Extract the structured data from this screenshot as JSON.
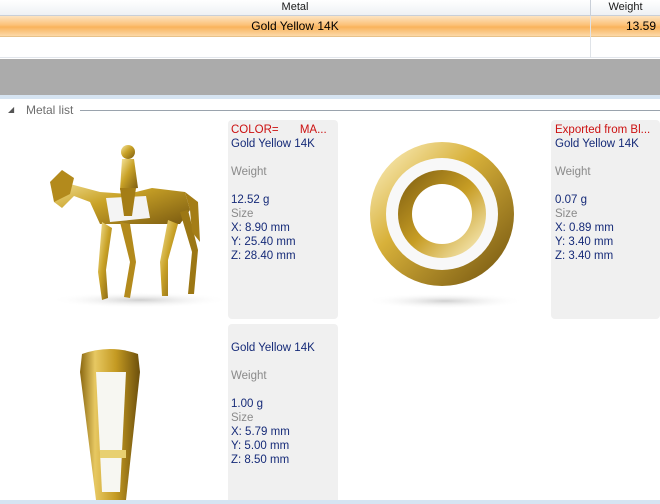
{
  "grid": {
    "columns": {
      "metal": "Metal",
      "weight": "Weight"
    },
    "rows": [
      {
        "metal": "Gold Yellow 14K",
        "weight": "13.59"
      }
    ]
  },
  "group": {
    "title": "Metal list"
  },
  "cards": [
    {
      "header_left": "COLOR=",
      "header_right": "MA...",
      "metal": "Gold Yellow 14K",
      "weight_label": "Weight",
      "weight": "12.52 g",
      "size_label": "Size",
      "x": "X: 8.90 mm",
      "y": "Y: 25.40 mm",
      "z": "Z: 28.40 mm"
    },
    {
      "header_left": "Exported from Bl...",
      "metal": "Gold Yellow 14K",
      "weight_label": "Weight",
      "weight": "0.07 g",
      "size_label": "Size",
      "x": "X: 0.89 mm",
      "y": "Y: 3.40 mm",
      "z": "Z: 3.40 mm"
    },
    {
      "metal": "Gold Yellow 14K",
      "weight_label": "Weight",
      "weight": "1.00 g",
      "size_label": "Size",
      "x": "X: 5.79 mm",
      "y": "Y: 5.00 mm",
      "z": "Z: 8.50 mm"
    }
  ],
  "colors": {
    "selection": "#fcc178",
    "gold": "#c9a227",
    "panel": "#f0f0f0",
    "accent_red": "#cc1111",
    "text_blue": "#152a78"
  }
}
